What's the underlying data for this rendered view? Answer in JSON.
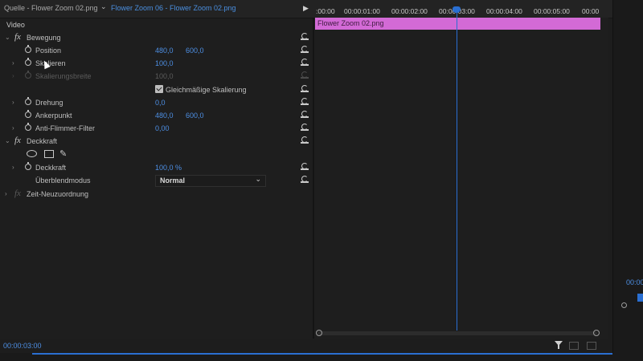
{
  "tabs": {
    "source": "Quelle - Flower Zoom 02.png",
    "sequence": "Flower Zoom 06 - Flower Zoom 02.png"
  },
  "effects": {
    "section": "Video",
    "motion": {
      "title": "Bewegung",
      "position": {
        "label": "Position",
        "x": "480,0",
        "y": "600,0"
      },
      "scale": {
        "label": "Skalieren",
        "value": "100,0"
      },
      "scale_width": {
        "label": "Skalierungsbreite",
        "value": "100,0"
      },
      "uniform": {
        "label": "Gleichmäßige Skalierung",
        "checked": true
      },
      "rotation": {
        "label": "Drehung",
        "value": "0,0"
      },
      "anchor": {
        "label": "Ankerpunkt",
        "x": "480,0",
        "y": "600,0"
      },
      "antiflicker": {
        "label": "Anti-Flimmer-Filter",
        "value": "0,00"
      }
    },
    "opacity": {
      "title": "Deckkraft",
      "value_label": "Deckkraft",
      "value": "100,0 %",
      "blend_label": "Überblendmodus",
      "blend_value": "Normal"
    },
    "time_remap": {
      "title": "Zeit-Neuzuordnung"
    }
  },
  "timeline": {
    "ticks": [
      ":00:00",
      "00:00:01:00",
      "00:00:02:00",
      "00:00:03:00",
      "00:00:04:00",
      "00:00:05:00",
      "00:00"
    ],
    "clip_name": "Flower Zoom 02.png",
    "playhead": "00:00:03:00"
  },
  "current_timecode": "00:00:03:00",
  "right_timecode": "00:00",
  "colors": {
    "accent": "#4d8fe4",
    "clip": "#d36ad6",
    "playhead": "#2a6fd2"
  }
}
